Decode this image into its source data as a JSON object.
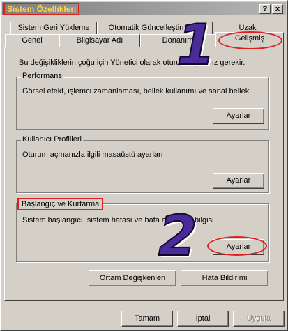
{
  "window": {
    "title": "Sistem Özellikleri",
    "help_btn": "?",
    "close_btn": "x"
  },
  "tabs_back": [
    "Sistem Geri Yükleme",
    "Otomatik Güncelleştirmeler",
    "Uzak"
  ],
  "tabs_front": [
    "Genel",
    "Bilgisayar Adı",
    "Donanım",
    "Gelişmiş"
  ],
  "notice": "Bu değişikliklerin çoğu için Yönetici olarak oturum açmanız gerekir.",
  "groups": {
    "performance": {
      "label": "Performans",
      "desc": "Görsel efekt, işlemci zamanlaması, bellek kullanımı ve sanal bellek",
      "button": "Ayarlar"
    },
    "profiles": {
      "label": "Kullanıcı Profilleri",
      "desc": "Oturum açmanızla ilgili masaüstü ayarları",
      "button": "Ayarlar"
    },
    "startup": {
      "label": "Başlangıç ve Kurtarma",
      "desc": "Sistem başlangıcı, sistem hatası ve hata ayıklama bilgisi",
      "button": "Ayarlar"
    }
  },
  "env_button": "Ortam Değişkenleri",
  "error_button": "Hata Bildirimi",
  "footer": {
    "ok": "Tamam",
    "cancel": "İptal",
    "apply": "Uygula"
  },
  "annotations": {
    "step1": "1",
    "step2": "2"
  },
  "colors": {
    "highlight": "#e02020",
    "title_text": "#ffd24a",
    "numeral": "#4b2a9a"
  }
}
